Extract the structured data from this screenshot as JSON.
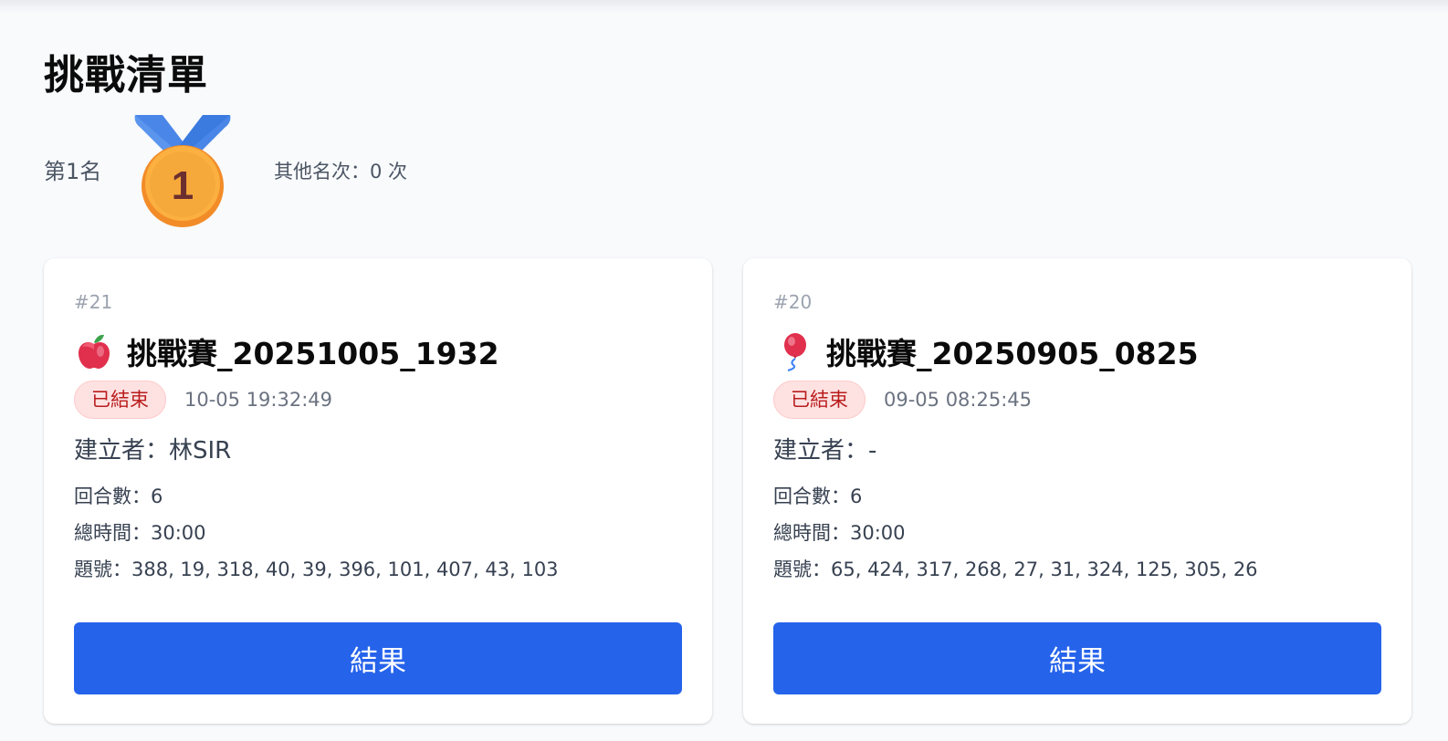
{
  "page": {
    "title": "挑戰清單"
  },
  "ranking": {
    "first_label": "第1名",
    "medal_number": "1",
    "other_label": "其他名次：0 次"
  },
  "colors": {
    "primary_button": "#2563eb",
    "badge_bg": "#fee2e2",
    "badge_text": "#b91c1c",
    "medal_ribbon": "#3b82f6",
    "medal_gold": "#f59e0b"
  },
  "challenges": [
    {
      "id": "#21",
      "icon": "apple-icon",
      "title": "挑戰賽_20251005_1932",
      "status": "已結束",
      "time": "10-05 19:32:49",
      "creator": "建立者：林SIR",
      "rounds": "回合數：6",
      "total_time": "總時間：30:00",
      "questions": "題號：388, 19, 318, 40, 39, 396, 101, 407, 43, 103",
      "button_label": "結果"
    },
    {
      "id": "#20",
      "icon": "balloon-icon",
      "title": "挑戰賽_20250905_0825",
      "status": "已結束",
      "time": "09-05 08:25:45",
      "creator": "建立者：-",
      "rounds": "回合數：6",
      "total_time": "總時間：30:00",
      "questions": "題號：65, 424, 317, 268, 27, 31, 324, 125, 305, 26",
      "button_label": "結果"
    }
  ]
}
